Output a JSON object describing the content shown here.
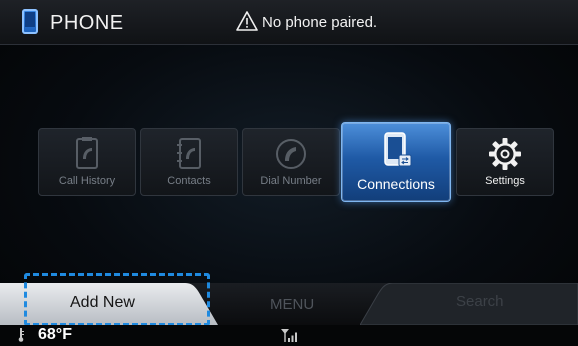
{
  "header": {
    "title": "PHONE",
    "status": "No phone paired."
  },
  "tiles": [
    {
      "label": "Call History",
      "icon": "call-history-icon",
      "state": "disabled"
    },
    {
      "label": "Contacts",
      "icon": "contacts-icon",
      "state": "disabled"
    },
    {
      "label": "Dial Number",
      "icon": "dial-number-icon",
      "state": "disabled"
    },
    {
      "label": "Connections",
      "icon": "connections-icon",
      "state": "selected"
    },
    {
      "label": "Settings",
      "icon": "settings-icon",
      "state": "enabled"
    }
  ],
  "bottom_nav": {
    "add_new": "Add New",
    "menu": "MENU",
    "search": "Search"
  },
  "status_bar": {
    "temperature": "68°F"
  },
  "colors": {
    "accent": "#3a7fd0",
    "focus_outline": "#1f8ae0",
    "background": "#05080c"
  }
}
